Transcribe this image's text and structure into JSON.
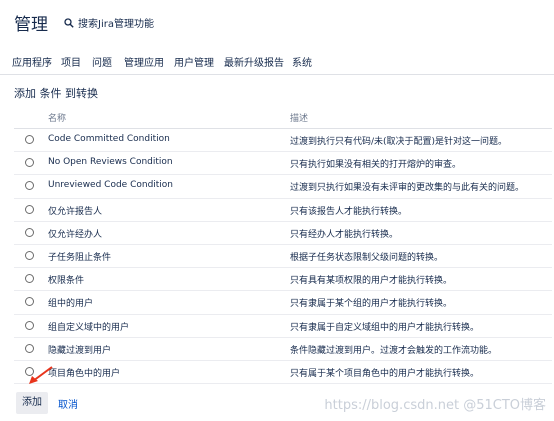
{
  "header": {
    "title": "管理",
    "search_label": "搜索Jira管理功能"
  },
  "nav": [
    "应用程序",
    "项目",
    "问题",
    "管理应用",
    "用户管理",
    "最新升级报告",
    "系统"
  ],
  "heading": "添加 条件 到转换",
  "table": {
    "col_name": "名称",
    "col_desc": "描述",
    "rows": [
      {
        "name": "Code Committed Condition",
        "desc": "过渡到执行只有代码/未(取决于配置)是针对这一问题。"
      },
      {
        "name": "No Open Reviews Condition",
        "desc": "只有执行如果没有相关的打开熔炉的审查。"
      },
      {
        "name": "Unreviewed Code Condition",
        "desc": "过渡到只执行如果没有未评审的更改集的与此有关的问题。"
      },
      {
        "name": "仅允许报告人",
        "desc": "只有该报告人才能执行转换。"
      },
      {
        "name": "仅允许经办人",
        "desc": "只有经办人才能执行转换。"
      },
      {
        "name": "子任务阻止条件",
        "desc": "根据子任务状态限制父级问题的转换。"
      },
      {
        "name": "权限条件",
        "desc": "只有具有某项权限的用户才能执行转换。"
      },
      {
        "name": "组中的用户",
        "desc": "只有隶属于某个组的用户才能执行转换。"
      },
      {
        "name": "组自定义域中的用户",
        "desc": "只有隶属于自定义域组中的用户才能执行转换。"
      },
      {
        "name": "隐藏过渡到用户",
        "desc": "条件隐藏过渡到用户。过渡才会触发的工作流功能。"
      },
      {
        "name": "项目角色中的用户",
        "desc": "只有属于某个项目角色中的用户才能执行转换。"
      }
    ]
  },
  "footer": {
    "add": "添加",
    "cancel": "取消"
  },
  "watermark": "https://blog.csdn.net @51CTO博客",
  "colors": {
    "accent": "#0052cc",
    "arrow": "#e8341c"
  },
  "icons": {
    "search": "search-icon",
    "arrow": "arrow-annotation"
  }
}
